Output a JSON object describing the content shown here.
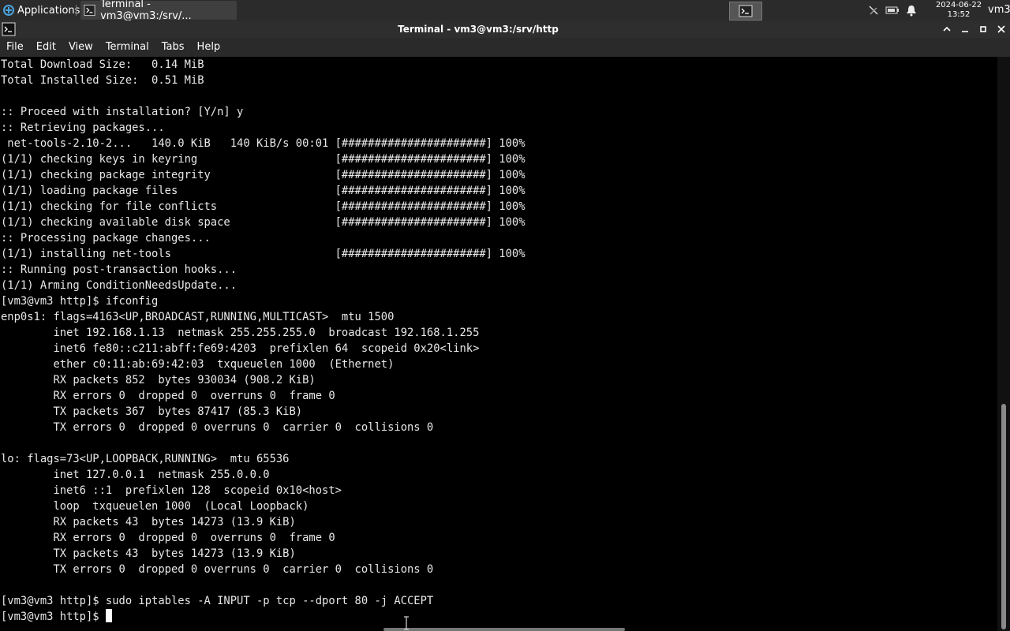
{
  "panel": {
    "applications_label": "Applications",
    "task_label": "Terminal - vm3@vm3:/srv/...",
    "clock_date": "2024-06-22",
    "clock_time": "13:52",
    "user": "vm3"
  },
  "window": {
    "title": "Terminal - vm3@vm3:/srv/http"
  },
  "menubar": [
    "File",
    "Edit",
    "View",
    "Terminal",
    "Tabs",
    "Help"
  ],
  "terminal": {
    "lines": [
      "Total Download Size:   0.14 MiB",
      "Total Installed Size:  0.51 MiB",
      "",
      ":: Proceed with installation? [Y/n] y",
      ":: Retrieving packages...",
      " net-tools-2.10-2...   140.0 KiB   140 KiB/s 00:01 [######################] 100%",
      "(1/1) checking keys in keyring                     [######################] 100%",
      "(1/1) checking package integrity                   [######################] 100%",
      "(1/1) loading package files                        [######################] 100%",
      "(1/1) checking for file conflicts                  [######################] 100%",
      "(1/1) checking available disk space                [######################] 100%",
      ":: Processing package changes...",
      "(1/1) installing net-tools                         [######################] 100%",
      ":: Running post-transaction hooks...",
      "(1/1) Arming ConditionNeedsUpdate...",
      "[vm3@vm3 http]$ ifconfig",
      "enp0s1: flags=4163<UP,BROADCAST,RUNNING,MULTICAST>  mtu 1500",
      "        inet 192.168.1.13  netmask 255.255.255.0  broadcast 192.168.1.255",
      "        inet6 fe80::c211:abff:fe69:4203  prefixlen 64  scopeid 0x20<link>",
      "        ether c0:11:ab:69:42:03  txqueuelen 1000  (Ethernet)",
      "        RX packets 852  bytes 930034 (908.2 KiB)",
      "        RX errors 0  dropped 0  overruns 0  frame 0",
      "        TX packets 367  bytes 87417 (85.3 KiB)",
      "        TX errors 0  dropped 0 overruns 0  carrier 0  collisions 0",
      "",
      "lo: flags=73<UP,LOOPBACK,RUNNING>  mtu 65536",
      "        inet 127.0.0.1  netmask 255.0.0.0",
      "        inet6 ::1  prefixlen 128  scopeid 0x10<host>",
      "        loop  txqueuelen 1000  (Local Loopback)",
      "        RX packets 43  bytes 14273 (13.9 KiB)",
      "        RX errors 0  dropped 0  overruns 0  frame 0",
      "        TX packets 43  bytes 14273 (13.9 KiB)",
      "        TX errors 0  dropped 0 overruns 0  carrier 0  collisions 0",
      "",
      "[vm3@vm3 http]$ sudo iptables -A INPUT -p tcp --dport 80 -j ACCEPT"
    ],
    "prompt": "[vm3@vm3 http]$ "
  },
  "colors": {
    "terminal_bg": "#000000",
    "terminal_fg": "#e8e8e8",
    "panel_bg": "#2b2b2b"
  }
}
